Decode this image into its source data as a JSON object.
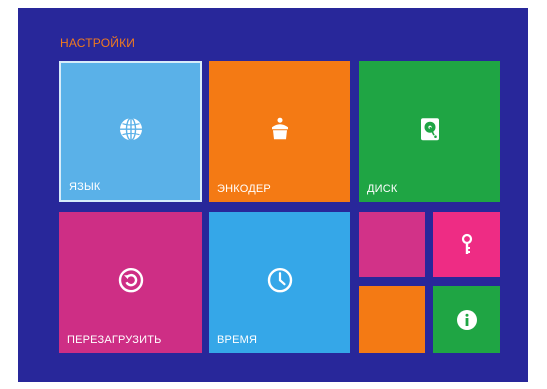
{
  "screen": {
    "title": "НАСТРОЙКИ"
  },
  "tiles": {
    "language": {
      "label": "ЯЗЫК",
      "icon": "globe-icon",
      "color": "#5ab1e8"
    },
    "encoder": {
      "label": "ЭНКОДЕР",
      "icon": "encoder-icon",
      "color": "#f47a14"
    },
    "disk": {
      "label": "ДИСК",
      "icon": "hard-drive-icon",
      "color": "#1fa544"
    },
    "reboot": {
      "label": "ПЕРЕЗАГРУЗИТЬ",
      "icon": "reboot-icon",
      "color": "#ce2e85"
    },
    "time": {
      "label": "ВРЕМЯ",
      "icon": "clock-icon",
      "color": "#35a7e8"
    },
    "blank_pink": {
      "color": "#d23288"
    },
    "key": {
      "icon": "key-icon",
      "color": "#ee2c84"
    },
    "blank_orange": {
      "color": "#f47a14"
    },
    "info": {
      "icon": "info-icon",
      "color": "#1fa544"
    }
  },
  "colors": {
    "background": "#28279a",
    "title": "#f07a1e"
  }
}
